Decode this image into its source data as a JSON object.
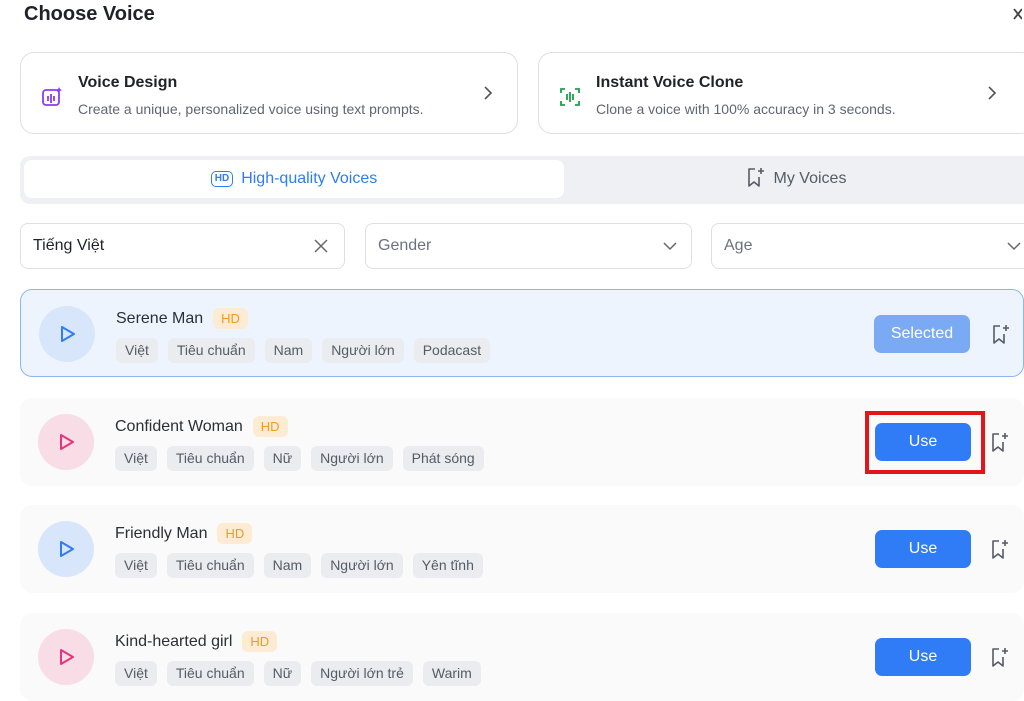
{
  "header": {
    "title": "Choose Voice"
  },
  "cards": [
    {
      "title": "Voice Design",
      "desc": "Create a unique, personalized voice using text prompts."
    },
    {
      "title": "Instant Voice Clone",
      "desc": "Clone a voice with 100% accuracy in 3 seconds."
    }
  ],
  "tabs": {
    "hq": "High-quality Voices",
    "hd_icon_text": "HD",
    "my": "My Voices"
  },
  "filters": {
    "language": "Tiếng Việt",
    "gender": "Gender",
    "age": "Age"
  },
  "voices": [
    {
      "name": "Serene Man",
      "badge": "HD",
      "tags": [
        "Việt",
        "Tiêu chuẩn",
        "Nam",
        "Người lớn",
        "Podacast"
      ],
      "action": "Selected"
    },
    {
      "name": "Confident Woman",
      "badge": "HD",
      "tags": [
        "Việt",
        "Tiêu chuẩn",
        "Nữ",
        "Người lớn",
        "Phát sóng"
      ],
      "action": "Use"
    },
    {
      "name": "Friendly Man",
      "badge": "HD",
      "tags": [
        "Việt",
        "Tiêu chuẩn",
        "Nam",
        "Người lớn",
        "Yên tĩnh"
      ],
      "action": "Use"
    },
    {
      "name": "Kind-hearted girl",
      "badge": "HD",
      "tags": [
        "Việt",
        "Tiêu chuẩn",
        "Nữ",
        "Người lớn trẻ",
        "Warim"
      ],
      "action": "Use"
    }
  ],
  "colors": {
    "accent": "#2f7cf6",
    "selected_button": "#7aaaf3",
    "hd_badge": "#f39b21",
    "highlight": "#e0161b"
  }
}
